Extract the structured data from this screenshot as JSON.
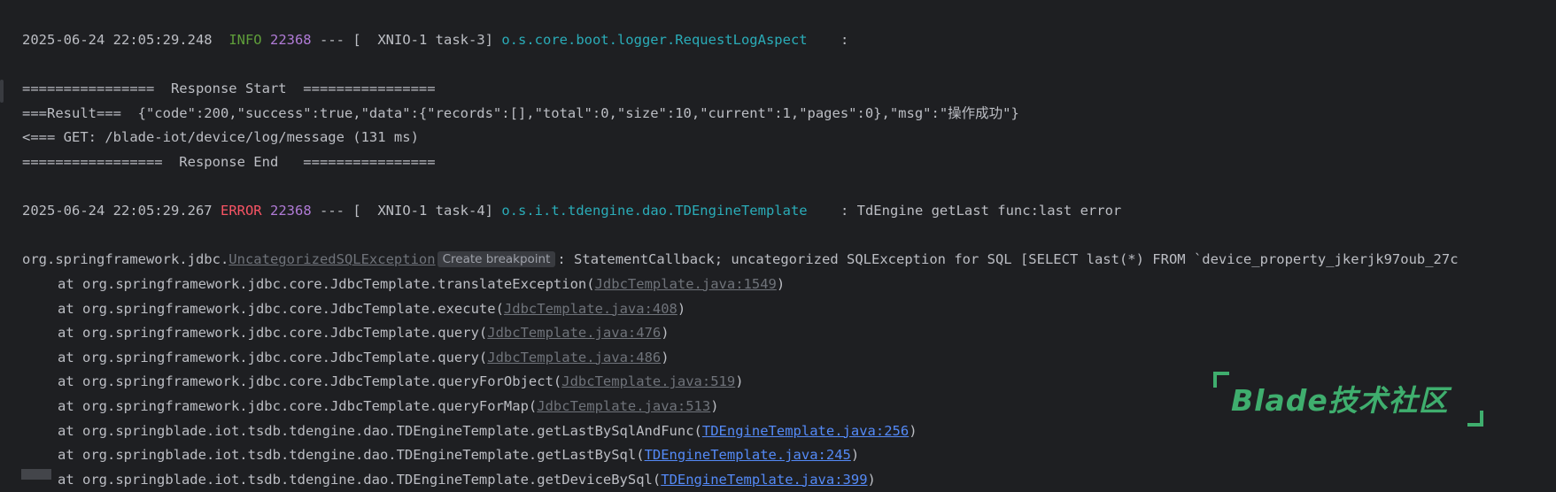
{
  "log": {
    "entry1": {
      "timestamp": "2025-06-24 22:05:29.248",
      "level": "INFO",
      "pid": "22368",
      "separator": "---",
      "thread": "[  XNIO-1 task-3]",
      "logger": "o.s.core.boot.logger.RequestLogAspect",
      "message": ":"
    },
    "response": {
      "start": "================  Response Start  ================",
      "result": "===Result===  {\"code\":200,\"success\":true,\"data\":{\"records\":[],\"total\":0,\"size\":10,\"current\":1,\"pages\":0},\"msg\":\"操作成功\"}",
      "request": "<=== GET: /blade-iot/device/log/message (131 ms)",
      "end": "=================  Response End   ================"
    },
    "entry2": {
      "timestamp": "2025-06-24 22:05:29.267",
      "level": "ERROR",
      "pid": "22368",
      "separator": "---",
      "thread": "[  XNIO-1 task-4]",
      "logger": "o.s.i.t.tdengine.dao.TDEngineTemplate",
      "message": ": TdEngine getLast func:last error"
    },
    "exception": {
      "package": "org.springframework.jdbc.",
      "class_name": "UncategorizedSQLException",
      "breakpoint_label": "Create breakpoint",
      "message": ": StatementCallback; uncategorized SQLException for SQL [SELECT last(*) FROM `device_property_jkerjk97oub_27c"
    },
    "stack": [
      {
        "prefix": "at org.springframework.jdbc.core.JdbcTemplate.translateException(",
        "link": "JdbcTemplate.java:1549",
        "suffix": ")",
        "link_style": "grey"
      },
      {
        "prefix": "at org.springframework.jdbc.core.JdbcTemplate.execute(",
        "link": "JdbcTemplate.java:408",
        "suffix": ")",
        "link_style": "grey"
      },
      {
        "prefix": "at org.springframework.jdbc.core.JdbcTemplate.query(",
        "link": "JdbcTemplate.java:476",
        "suffix": ")",
        "link_style": "grey"
      },
      {
        "prefix": "at org.springframework.jdbc.core.JdbcTemplate.query(",
        "link": "JdbcTemplate.java:486",
        "suffix": ")",
        "link_style": "grey"
      },
      {
        "prefix": "at org.springframework.jdbc.core.JdbcTemplate.queryForObject(",
        "link": "JdbcTemplate.java:519",
        "suffix": ")",
        "link_style": "grey"
      },
      {
        "prefix": "at org.springframework.jdbc.core.JdbcTemplate.queryForMap(",
        "link": "JdbcTemplate.java:513",
        "suffix": ")",
        "link_style": "grey"
      },
      {
        "prefix": "at org.springblade.iot.tsdb.tdengine.dao.TDEngineTemplate.getLastBySqlAndFunc(",
        "link": "TDEngineTemplate.java:256",
        "suffix": ")",
        "link_style": "blue"
      },
      {
        "prefix": "at org.springblade.iot.tsdb.tdengine.dao.TDEngineTemplate.getLastBySql(",
        "link": "TDEngineTemplate.java:245",
        "suffix": ")",
        "link_style": "blue"
      },
      {
        "prefix": "at org.springblade.iot.tsdb.tdengine.dao.TDEngineTemplate.getDeviceBySql(",
        "link": "TDEngineTemplate.java:399",
        "suffix": ")",
        "link_style": "blue"
      }
    ]
  },
  "watermark": {
    "text": "Blade技术社区"
  },
  "colors": {
    "background": "#1e1f22",
    "text": "#bcbec4",
    "info": "#5f9e3a",
    "error": "#f75464",
    "pid": "#b07bd6",
    "logger": "#2aacb8",
    "link_grey": "#6f737a",
    "link_blue": "#548af7",
    "watermark": "#3fae6e"
  }
}
